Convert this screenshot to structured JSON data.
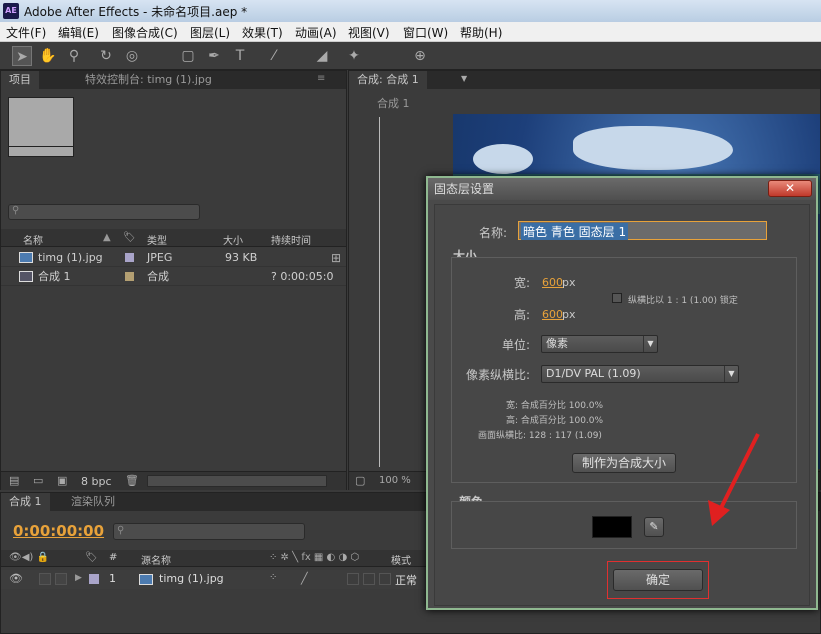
{
  "window": {
    "title": "Adobe After Effects - 未命名项目.aep *",
    "logo": "AE"
  },
  "menu": [
    "文件(F)",
    "编辑(E)",
    "图像合成(C)",
    "图层(L)",
    "效果(T)",
    "动画(A)",
    "视图(V)",
    "窗口(W)",
    "帮助(H)"
  ],
  "toolbar": {
    "icons": [
      "selection-icon",
      "hand-icon",
      "zoom-icon",
      "rotate-icon",
      "camera-icon",
      "rectangle-icon",
      "pen-icon",
      "text-icon",
      "brush-icon",
      "eraser-icon",
      "pin-icon"
    ]
  },
  "project_panel": {
    "tab_project": "项目",
    "tab_effects": "特效控制台: timg (1).jpg",
    "columns": [
      "名称",
      "类型",
      "大小",
      "持续时间"
    ],
    "items": [
      {
        "name": "timg (1).jpg",
        "type": "JPEG",
        "size": "93 KB",
        "duration": "",
        "label_color": "#a9a4c9"
      },
      {
        "name": "合成 1",
        "type": "合成",
        "size": "",
        "duration": "? 0:00:05:0",
        "label_color": "#b39f72"
      }
    ],
    "bpc": "8 bpc"
  },
  "comp_panel": {
    "tab": "合成: 合成 1",
    "breadcrumb": "合成 1",
    "zoom": "100 %"
  },
  "timeline": {
    "tab_comp": "合成 1",
    "tab_render": "渲染队列",
    "timecode": "0:00:00:00",
    "col_num": "#",
    "col_source": "源名称",
    "col_mode": "模式",
    "layer": {
      "index": "1",
      "name": "timg (1).jpg",
      "mode": "正常"
    }
  },
  "dialog": {
    "title": "固态层设置",
    "close": "✕",
    "name_label": "名称:",
    "name_value": "暗色 青色 固态层 1",
    "size_group": "大小",
    "width_label": "宽:",
    "width_value": "600",
    "height_label": "高:",
    "height_value": "600",
    "unit_px": "px",
    "lock_label": "纵横比以 1 : 1 (1.00) 锁定",
    "units_label": "单位:",
    "units_value": "像素",
    "par_label": "像素纵横比:",
    "par_value": "D1/DV PAL (1.09)",
    "info_width": "宽: 合成百分比 100.0%",
    "info_height": "高: 合成百分比 100.0%",
    "info_frame": "画面纵横比: 128 : 117 (1.09)",
    "make_comp_size": "制作为合成大小",
    "color_group": "颜色",
    "color_value": "#000000",
    "ok": "确定"
  }
}
